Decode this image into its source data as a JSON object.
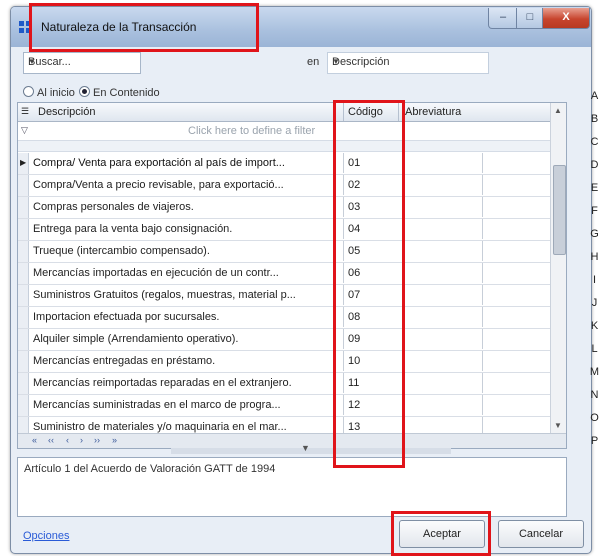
{
  "window": {
    "title": "Naturaleza de la Transacción",
    "controls": {
      "minimize": "–",
      "maximize": "□",
      "close": "X"
    }
  },
  "search": {
    "combo_label": "Buscar...",
    "en_label": "en",
    "field_value": "Descripción"
  },
  "search_mode": {
    "option1": "Al inicio",
    "option2": "En Contenido",
    "selected": "En Contenido"
  },
  "grid": {
    "columns": {
      "description": "Descripción",
      "code": "Código",
      "abbreviation": "Abreviatura"
    },
    "filter_hint": "Click here to define a filter",
    "rows": [
      {
        "description": "Compra/ Venta para exportación al país de import...",
        "code": "01"
      },
      {
        "description": "Compra/Venta a precio revisable, para exportació...",
        "code": "02"
      },
      {
        "description": "Compras personales de viajeros.",
        "code": "03"
      },
      {
        "description": "Entrega para la venta bajo consignación.",
        "code": "04"
      },
      {
        "description": "Trueque (intercambio compensado).",
        "code": "05"
      },
      {
        "description": "Mercancías importadas en ejecución de un contr...",
        "code": "06"
      },
      {
        "description": "Suministros Gratuitos (regalos, muestras, material p...",
        "code": "07"
      },
      {
        "description": "Importacion efectuada por sucursales.",
        "code": "08"
      },
      {
        "description": "Alquiler simple (Arrendamiento operativo).",
        "code": "09"
      },
      {
        "description": "Mercancías entregadas en préstamo.",
        "code": "10"
      },
      {
        "description": "Mercancías reimportadas reparadas en el extranjero.",
        "code": "11"
      },
      {
        "description": "Mercancías suministradas en el marco de progra...",
        "code": "12"
      },
      {
        "description": "Suministro de materiales y/o maquinaria en el mar...",
        "code": "13"
      }
    ],
    "navigator": {
      "first": "«",
      "prev_page": "‹‹",
      "prev": "‹",
      "next": "›",
      "next_page": "››",
      "last": "»"
    }
  },
  "note": "Artículo 1 del Acuerdo de Valoración GATT de 1994",
  "footer": {
    "options_link": "Opciones",
    "accept": "Aceptar",
    "cancel": "Cancelar"
  },
  "alphabet_index": [
    "A",
    "B",
    "C",
    "D",
    "E",
    "F",
    "G",
    "H",
    "I",
    "J",
    "K",
    "L",
    "M",
    "N",
    "O",
    "P"
  ],
  "highlight_color": "#e0141a"
}
